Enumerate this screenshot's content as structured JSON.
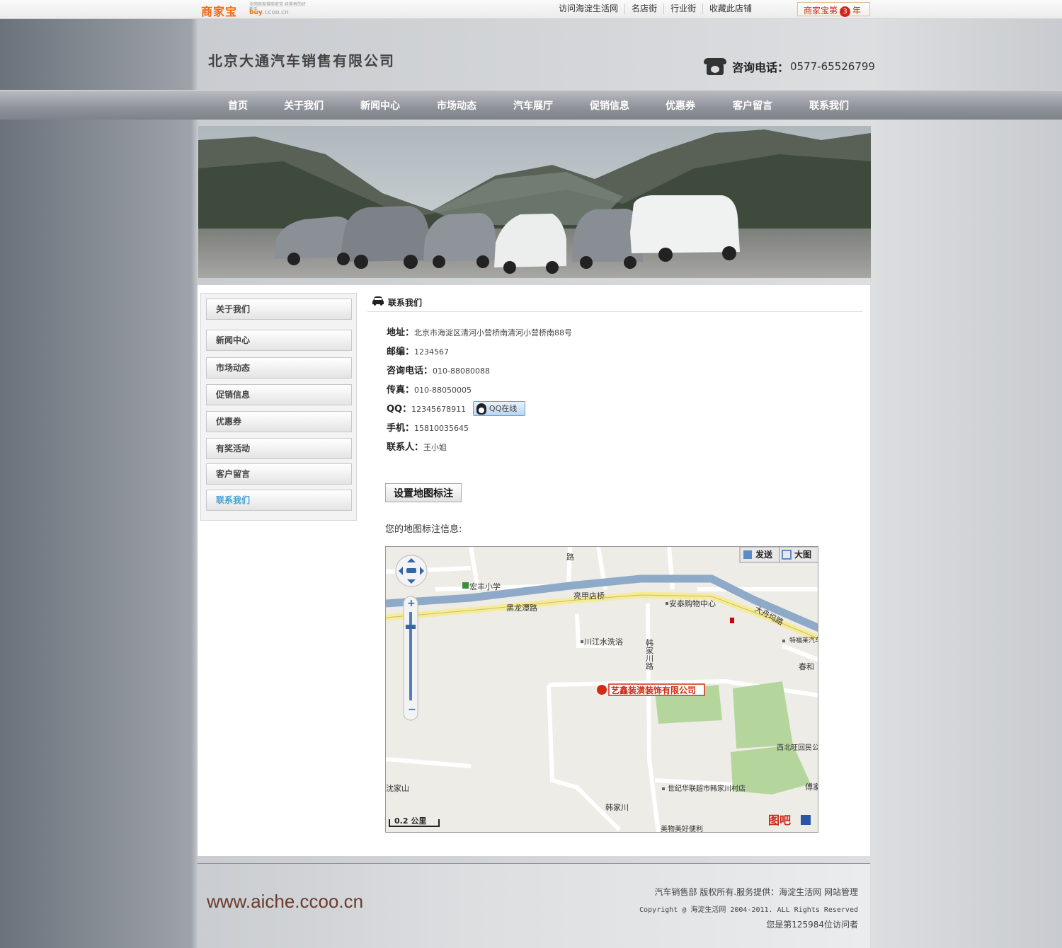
{
  "topbar": {
    "logo_text": "商家宝",
    "logo_sub": "全网商家推商家宝 经营者的好帮手",
    "logo_url": "buy",
    "logo_url_tail": ".ccoo.cn",
    "links": [
      "访问海淀生活网",
      "名店街",
      "行业街",
      "收藏此店铺"
    ],
    "badge_prefix": "商家宝第",
    "badge_num": "3",
    "badge_suffix": "年"
  },
  "header": {
    "company": "北京大通汽车销售有限公司",
    "phone_label": "咨询电话：",
    "phone_number": "0577-65526799"
  },
  "nav": [
    "首页",
    "关于我们",
    "新闻中心",
    "市场动态",
    "汽车展厅",
    "促销信息",
    "优惠券",
    "客户留言",
    "联系我们"
  ],
  "sidebar": [
    "关于我们",
    "新闻中心",
    "市场动态",
    "促销信息",
    "优惠券",
    "有奖活动",
    "客户留言",
    "联系我们"
  ],
  "contact": {
    "title": "联系我们",
    "address_label": "地址：",
    "address": "北京市海淀区清河小营桥南清河小营桥南88号",
    "zip_label": "邮编：",
    "zip": "1234567",
    "tel_label": "咨询电话：",
    "tel": "010-88080088",
    "fax_label": "传真：",
    "fax": "010-88050005",
    "qq_label": "QQ：",
    "qq": "12345678911",
    "qq_button": "QQ在线",
    "mobile_label": "手机：",
    "mobile": "15810035645",
    "person_label": "联系人：",
    "person": "王小姐"
  },
  "map": {
    "set_button": "设置地图标注",
    "info_label": "您的地图标注信息:",
    "send_label": "发送",
    "big_label": "大图",
    "scale": "0.2 公里",
    "brand": "图吧",
    "marker_label": "艺鑫装潢装饰有限公司",
    "places": [
      "宏丰小学",
      "亮甲店桥",
      "黑龙潭路",
      "安泰购物中心",
      "大舟坞路",
      "川江水洗浴",
      "韩家川路",
      "特福莱汽车维修装饰",
      "春和",
      "西北旺回民公寓",
      "世纪华联超市韩家川村店",
      "韩家川",
      "沈家山",
      "美物美好便利",
      "傅家"
    ]
  },
  "footer": {
    "site": "www.aiche.ccoo.cn",
    "line1": "汽车销售部 版权所有.服务提供：海淀生活网 网站管理",
    "line2": "Copyright @ 海淀生活网 2004-2011. ALL Rights Reserved",
    "line3": "您是第125984位访问者"
  },
  "colors": {
    "nav_text": "#ffffff",
    "active_side": "#48a0d8",
    "brand_orange": "#f26a10",
    "footer_site": "#6b3a2a"
  }
}
